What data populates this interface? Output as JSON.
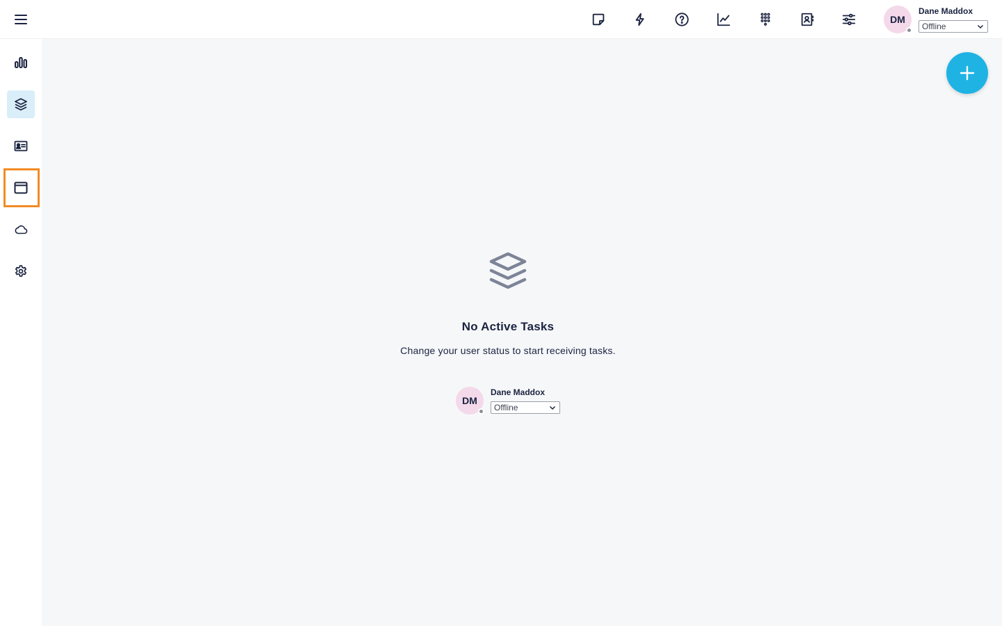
{
  "topbar": {
    "icons": [
      {
        "name": "sticky-note-icon"
      },
      {
        "name": "lightning-icon"
      },
      {
        "name": "help-icon"
      },
      {
        "name": "analytics-icon"
      },
      {
        "name": "dialpad-icon"
      },
      {
        "name": "contacts-icon"
      },
      {
        "name": "settings-sliders-icon"
      }
    ],
    "user": {
      "initials": "DM",
      "name": "Dane Maddox",
      "status": "Offline",
      "status_color": "#8a8f99"
    }
  },
  "sidebar": {
    "items": [
      {
        "name": "reports-icon",
        "active": false
      },
      {
        "name": "tasks-icon",
        "active": true
      },
      {
        "name": "contact-card-icon",
        "active": false
      },
      {
        "name": "window-icon",
        "active": false,
        "highlighted": true
      },
      {
        "name": "cloud-icon",
        "active": false
      },
      {
        "name": "settings-icon",
        "active": false
      }
    ]
  },
  "main": {
    "empty_title": "No Active Tasks",
    "empty_subtitle": "Change your user status to start receiving tasks.",
    "user": {
      "initials": "DM",
      "name": "Dane Maddox",
      "status": "Offline"
    }
  },
  "colors": {
    "accent": "#1fb3e3",
    "highlight": "#f28b24",
    "sidebar_active_bg": "#d9eef9",
    "avatar_bg": "#f3d9ea",
    "text": "#1a2340"
  }
}
